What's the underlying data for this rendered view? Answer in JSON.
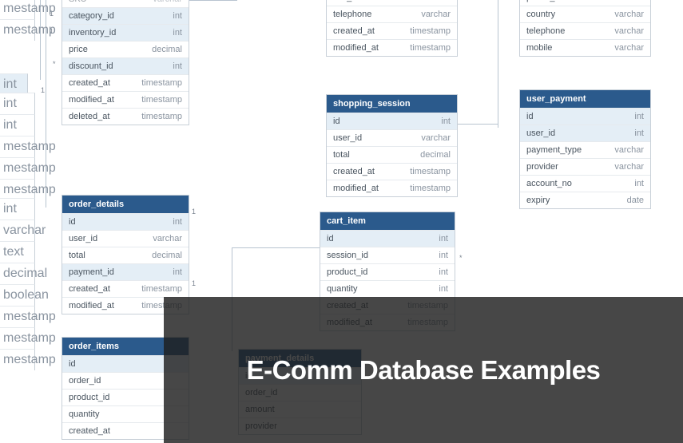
{
  "overlay": {
    "title": "E-Comm Database Examples"
  },
  "left_partial_a": [
    {
      "type": "mestamp"
    },
    {
      "type": "mestamp"
    }
  ],
  "left_partial_b": [
    {
      "type": "int",
      "hl": true
    }
  ],
  "left_partial_c": [
    {
      "type": "int"
    },
    {
      "type": "int"
    },
    {
      "type": "mestamp"
    },
    {
      "type": "mestamp"
    },
    {
      "type": "mestamp"
    }
  ],
  "left_partial_d": [
    {
      "type": "int"
    },
    {
      "type": "varchar"
    },
    {
      "type": "text"
    },
    {
      "type": "decimal"
    },
    {
      "type": "boolean"
    },
    {
      "type": "mestamp"
    },
    {
      "type": "mestamp"
    },
    {
      "type": "mestamp"
    }
  ],
  "product_partial": {
    "rows": [
      {
        "name": "SKU",
        "type": "varchar",
        "faint": true
      },
      {
        "name": "category_id",
        "type": "int",
        "hl": true
      },
      {
        "name": "inventory_id",
        "type": "int",
        "hl": true
      },
      {
        "name": "price",
        "type": "decimal"
      },
      {
        "name": "discount_id",
        "type": "int",
        "hl": true
      },
      {
        "name": "created_at",
        "type": "timestamp"
      },
      {
        "name": "modified_at",
        "type": "timestamp"
      },
      {
        "name": "deleted_at",
        "type": "timestamp"
      }
    ]
  },
  "order_details": {
    "title": "order_details",
    "rows": [
      {
        "name": "id",
        "type": "int",
        "hl": true
      },
      {
        "name": "user_id",
        "type": "varchar"
      },
      {
        "name": "total",
        "type": "decimal"
      },
      {
        "name": "payment_id",
        "type": "int",
        "hl": true
      },
      {
        "name": "created_at",
        "type": "timestamp"
      },
      {
        "name": "modified_at",
        "type": "timestamp"
      }
    ]
  },
  "order_items": {
    "title": "order_items",
    "rows": [
      {
        "name": "id",
        "type": ""
      },
      {
        "name": "order_id",
        "type": ""
      },
      {
        "name": "product_id",
        "type": ""
      },
      {
        "name": "quantity",
        "type": ""
      },
      {
        "name": "created_at",
        "type": ""
      }
    ]
  },
  "user_partial": {
    "rows": [
      {
        "name": "last_name",
        "type": "varchar"
      },
      {
        "name": "telephone",
        "type": "varchar"
      },
      {
        "name": "created_at",
        "type": "timestamp"
      },
      {
        "name": "modified_at",
        "type": "timestamp"
      }
    ]
  },
  "shopping_session": {
    "title": "shopping_session",
    "rows": [
      {
        "name": "id",
        "type": "int",
        "hl": true
      },
      {
        "name": "user_id",
        "type": "varchar"
      },
      {
        "name": "total",
        "type": "decimal"
      },
      {
        "name": "created_at",
        "type": "timestamp"
      },
      {
        "name": "modified_at",
        "type": "timestamp"
      }
    ]
  },
  "cart_item": {
    "title": "cart_item",
    "rows": [
      {
        "name": "id",
        "type": "int",
        "hl": true
      },
      {
        "name": "session_id",
        "type": "int"
      },
      {
        "name": "product_id",
        "type": "int"
      },
      {
        "name": "quantity",
        "type": "int"
      },
      {
        "name": "created_at",
        "type": "timestamp"
      },
      {
        "name": "modified_at",
        "type": "timestamp"
      }
    ]
  },
  "address_partial": {
    "rows": [
      {
        "name": "postal_code",
        "type": "varchar"
      },
      {
        "name": "country",
        "type": "varchar"
      },
      {
        "name": "telephone",
        "type": "varchar"
      },
      {
        "name": "mobile",
        "type": "varchar"
      }
    ]
  },
  "user_payment": {
    "title": "user_payment",
    "rows": [
      {
        "name": "id",
        "type": "int",
        "hl": true
      },
      {
        "name": "user_id",
        "type": "int",
        "hl": true
      },
      {
        "name": "payment_type",
        "type": "varchar"
      },
      {
        "name": "provider",
        "type": "varchar"
      },
      {
        "name": "account_no",
        "type": "int"
      },
      {
        "name": "expiry",
        "type": "date"
      }
    ]
  },
  "payment_details": {
    "title": "payment_details",
    "rows": [
      {
        "name": "id",
        "type": ""
      },
      {
        "name": "order_id",
        "type": ""
      },
      {
        "name": "amount",
        "type": ""
      },
      {
        "name": "provider",
        "type": ""
      }
    ]
  },
  "colors": {
    "header": "#2b5a8c",
    "hl": "#e4eef6"
  }
}
